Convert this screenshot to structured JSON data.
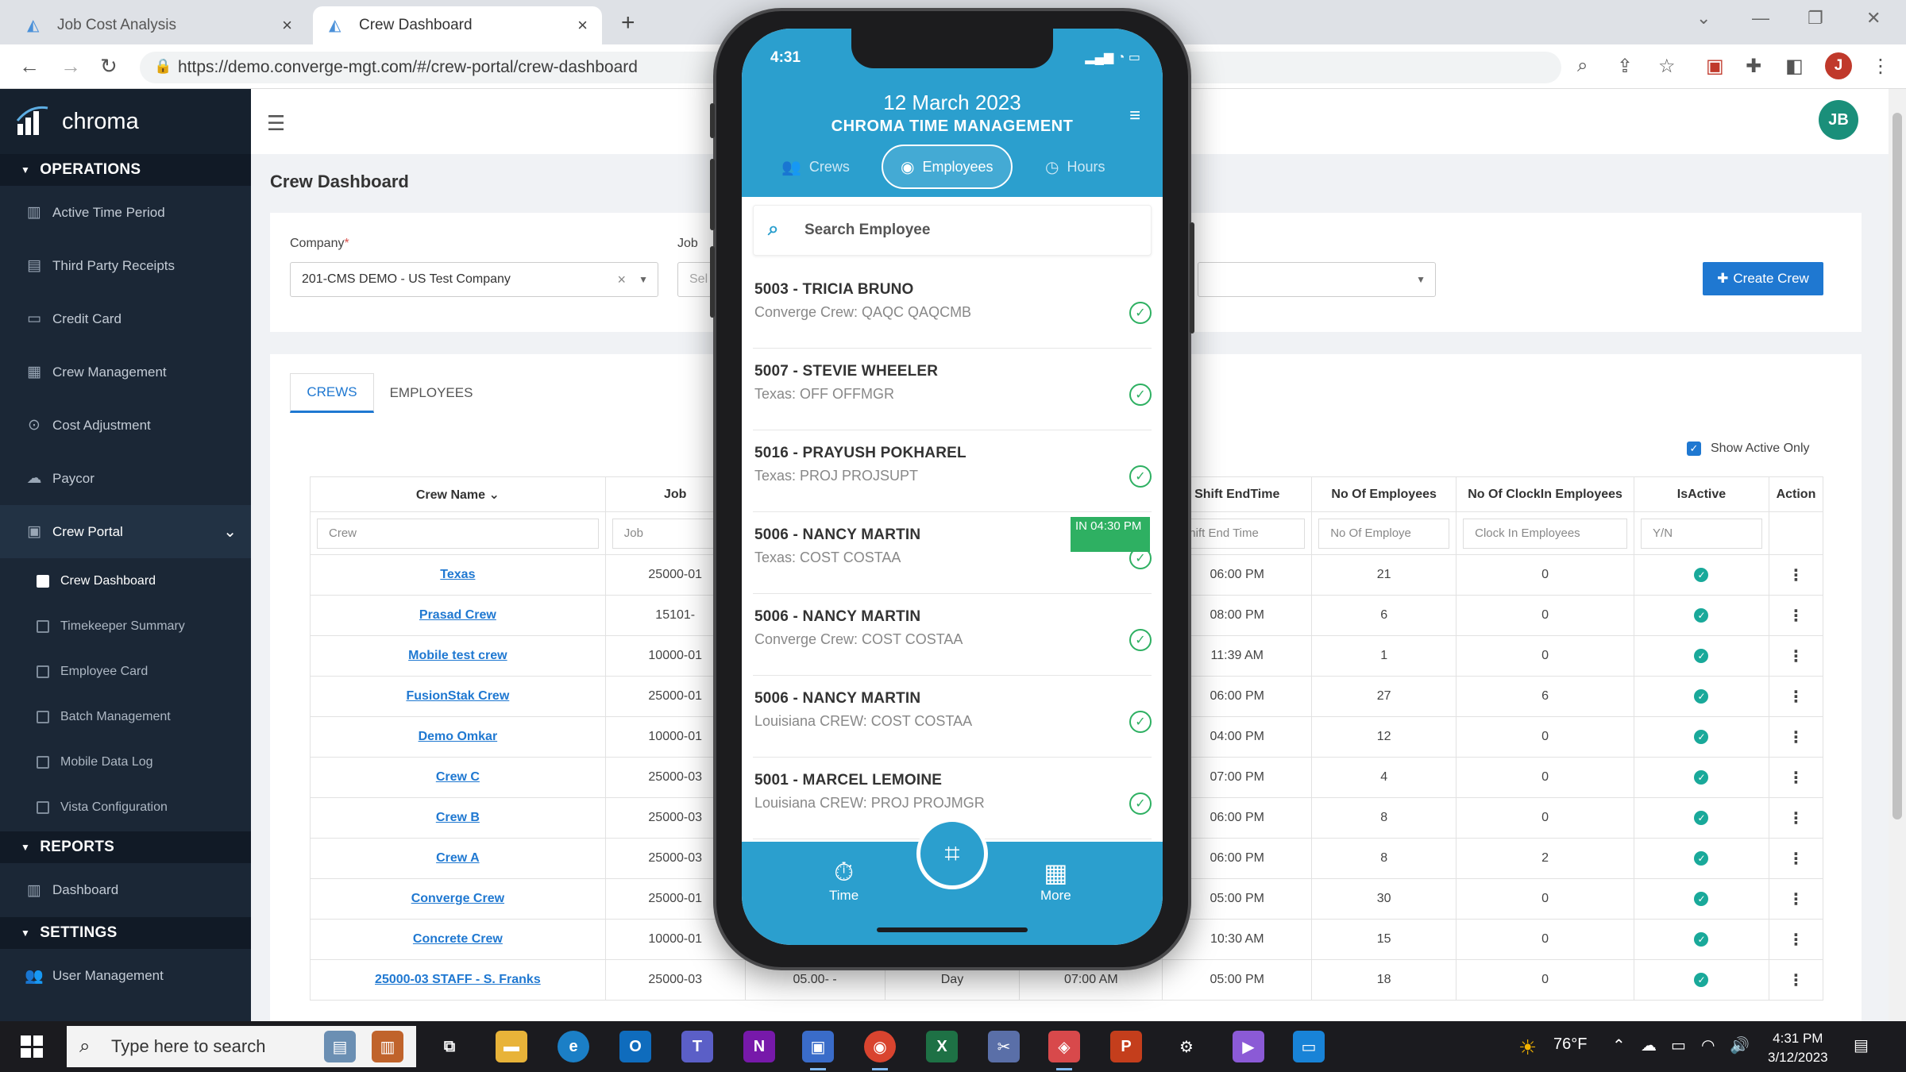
{
  "browser": {
    "tabs": [
      {
        "title": "Job Cost Analysis",
        "active": false
      },
      {
        "title": "Crew Dashboard",
        "active": true
      }
    ],
    "url": "https://demo.converge-mgt.com/#/crew-portal/crew-dashboard",
    "profile_initial": "J"
  },
  "app": {
    "brand": "chroma",
    "user_initials": "JB"
  },
  "sidebar": {
    "operations_label": "OPERATIONS",
    "items": [
      {
        "label": "Active Time Period",
        "icon": "bars-icon"
      },
      {
        "label": "Third Party Receipts",
        "icon": "receipt-icon"
      },
      {
        "label": "Credit Card",
        "icon": "credit-card-icon"
      },
      {
        "label": "Crew Management",
        "icon": "crew-icon"
      },
      {
        "label": "Cost Adjustment",
        "icon": "adjust-icon"
      },
      {
        "label": "Paycor",
        "icon": "cloud-icon"
      }
    ],
    "crew_portal_label": "Crew Portal",
    "crew_portal_sub": [
      {
        "label": "Crew Dashboard",
        "active": true
      },
      {
        "label": "Timekeeper Summary",
        "active": false
      },
      {
        "label": "Employee Card",
        "active": false
      },
      {
        "label": "Batch Management",
        "active": false
      },
      {
        "label": "Mobile Data Log",
        "active": false
      },
      {
        "label": "Vista Configuration",
        "active": false
      }
    ],
    "reports_label": "REPORTS",
    "reports_items": [
      {
        "label": "Dashboard"
      }
    ],
    "settings_label": "SETTINGS",
    "settings_items": [
      {
        "label": "User Management"
      }
    ]
  },
  "page": {
    "title": "Crew Dashboard",
    "company_label": "Company",
    "company_value": "201-CMS DEMO - US Test Company",
    "job_label": "Job",
    "job_placeholder": "Sel",
    "create_button": "Create Crew",
    "tabs": [
      "CREWS",
      "EMPLOYEES"
    ],
    "show_active_label": "Show Active Only"
  },
  "table": {
    "headers": {
      "crew_name": "Crew Name",
      "job": "Job",
      "shift_end": "Shift EndTime",
      "no_employees": "No Of Employees",
      "no_clockin": "No Of ClockIn Employees",
      "is_active": "IsActive",
      "action": "Action"
    },
    "filters": {
      "crew": "Crew",
      "job": "Job",
      "shift_end": "Shift End Time",
      "no_employees": "No Of Employe",
      "clockin": "Clock In Employees",
      "active": "Y/N"
    },
    "rows": [
      {
        "crew": "Texas",
        "job": "25000-01",
        "end": "06:00 PM",
        "emp": "21",
        "clock": "0"
      },
      {
        "crew": "Prasad Crew",
        "job": "15101-",
        "end": "08:00 PM",
        "emp": "6",
        "clock": "0"
      },
      {
        "crew": "Mobile test crew",
        "job": "10000-01",
        "end": "11:39 AM",
        "emp": "1",
        "clock": "0"
      },
      {
        "crew": "FusionStak Crew",
        "job": "25000-01",
        "end": "06:00 PM",
        "emp": "27",
        "clock": "6"
      },
      {
        "crew": "Demo Omkar",
        "job": "10000-01",
        "end": "04:00 PM",
        "emp": "12",
        "clock": "0"
      },
      {
        "crew": "Crew C",
        "job": "25000-03",
        "end": "07:00 PM",
        "emp": "4",
        "clock": "0"
      },
      {
        "crew": "Crew B",
        "job": "25000-03",
        "end": "06:00 PM",
        "emp": "8",
        "clock": "0"
      },
      {
        "crew": "Crew A",
        "job": "25000-03",
        "end": "06:00 PM",
        "emp": "8",
        "clock": "2"
      },
      {
        "crew": "Converge Crew",
        "job": "25000-01",
        "end": "05:00 PM",
        "emp": "30",
        "clock": "0"
      },
      {
        "crew": "Concrete Crew",
        "job": "10000-01",
        "end": "10:30 AM",
        "emp": "15",
        "clock": "0"
      }
    ],
    "last_row": {
      "crew": "25000-03 STAFF - S. Franks",
      "job": "25000-03",
      "extra1": "05.00- -",
      "extra2": "Day",
      "extra3": "07:00 AM",
      "end": "05:00 PM",
      "emp": "18",
      "clock": "0"
    }
  },
  "phone": {
    "time": "4:31",
    "date": "12 March 2023",
    "app_title": "CHROMA TIME MANAGEMENT",
    "tabs": [
      "Crews",
      "Employees",
      "Hours"
    ],
    "search_placeholder": "Search Employee",
    "employees": [
      {
        "name": "5003 - TRICIA BRUNO",
        "crew": "Converge Crew: QAQC QAQCMB",
        "badge": ""
      },
      {
        "name": "5007 - STEVIE WHEELER",
        "crew": "Texas: OFF OFFMGR",
        "badge": ""
      },
      {
        "name": "5016 - PRAYUSH POKHAREL",
        "crew": "Texas: PROJ PROJSUPT",
        "badge": ""
      },
      {
        "name": "5006 - NANCY MARTIN",
        "crew": "Texas: COST COSTAA",
        "badge": "IN 04:30 PM"
      },
      {
        "name": "5006 - NANCY MARTIN",
        "crew": "Converge Crew: COST COSTAA",
        "badge": ""
      },
      {
        "name": "5006 - NANCY MARTIN",
        "crew": "Louisiana CREW: COST COSTAA",
        "badge": ""
      },
      {
        "name": "5001 - MARCEL LEMOINE",
        "crew": "Louisiana CREW: PROJ PROJMGR",
        "badge": ""
      }
    ],
    "footer": {
      "time_label": "Time",
      "more_label": "More"
    }
  },
  "taskbar": {
    "search_placeholder": "Type here to search",
    "weather": "76°F",
    "clock_time": "4:31 PM",
    "clock_date": "3/12/2023"
  },
  "colors": {
    "accent": "#1f78d1",
    "sidebar": "#1b2736",
    "phone_header": "#2b9fce",
    "active_ok": "#19a99a"
  }
}
